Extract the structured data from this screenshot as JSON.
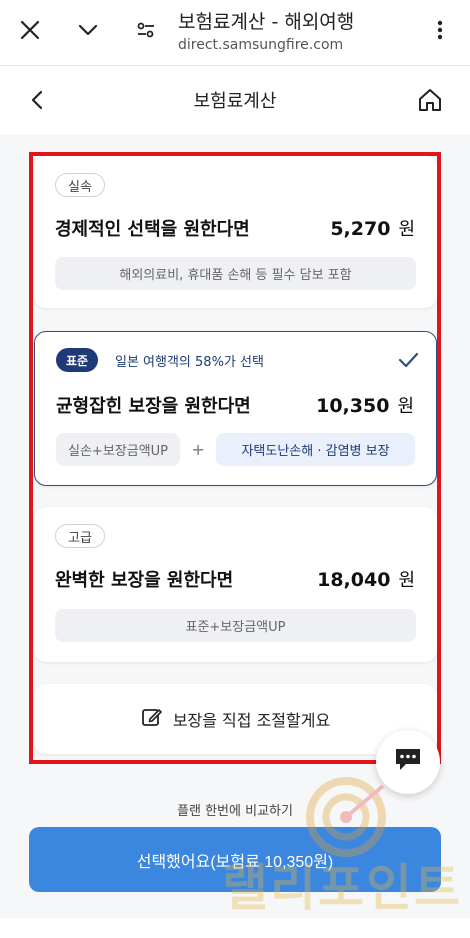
{
  "browser": {
    "title": "보험료계산 - 해외여행",
    "url": "direct.samsungfire.com"
  },
  "header": {
    "title": "보험료계산"
  },
  "plans": [
    {
      "tier": "실속",
      "title": "경제적인 선택을 원한다면",
      "price": "5,270",
      "unit": "원",
      "description": "해외의료비, 휴대품 손해 등 필수 담보 포함"
    },
    {
      "tier": "표준",
      "note": "일본 여행객의 58%가 선택",
      "title": "균형잡힌 보장을 원한다면",
      "price": "10,350",
      "unit": "원",
      "chip_left": "실손+보장금액UP",
      "plus": "+",
      "chip_right": "자택도난손해 · 감염병 보장",
      "selected": true
    },
    {
      "tier": "고급",
      "title": "완벽한 보장을 원한다면",
      "price": "18,040",
      "unit": "원",
      "description": "표준+보장금액UP"
    }
  ],
  "custom": {
    "label": "보장을 직접 조절할게요"
  },
  "compare_link": "플랜 한번에 비교하기",
  "select_button": "선택했어요(보험료 10,350원)",
  "watermark": "랠리포인트",
  "colors": {
    "highlight": "#e0141b",
    "primary_button": "#3b87e0",
    "badge_navy": "#1f3b77"
  },
  "icons": {
    "close": "close-icon",
    "chevron": "chevron-down-icon",
    "tune": "tune-icon",
    "menu": "more-vert-icon",
    "back": "back-arrow-icon",
    "home": "home-icon",
    "check": "check-icon",
    "edit": "edit-icon",
    "chat": "chat-icon"
  }
}
